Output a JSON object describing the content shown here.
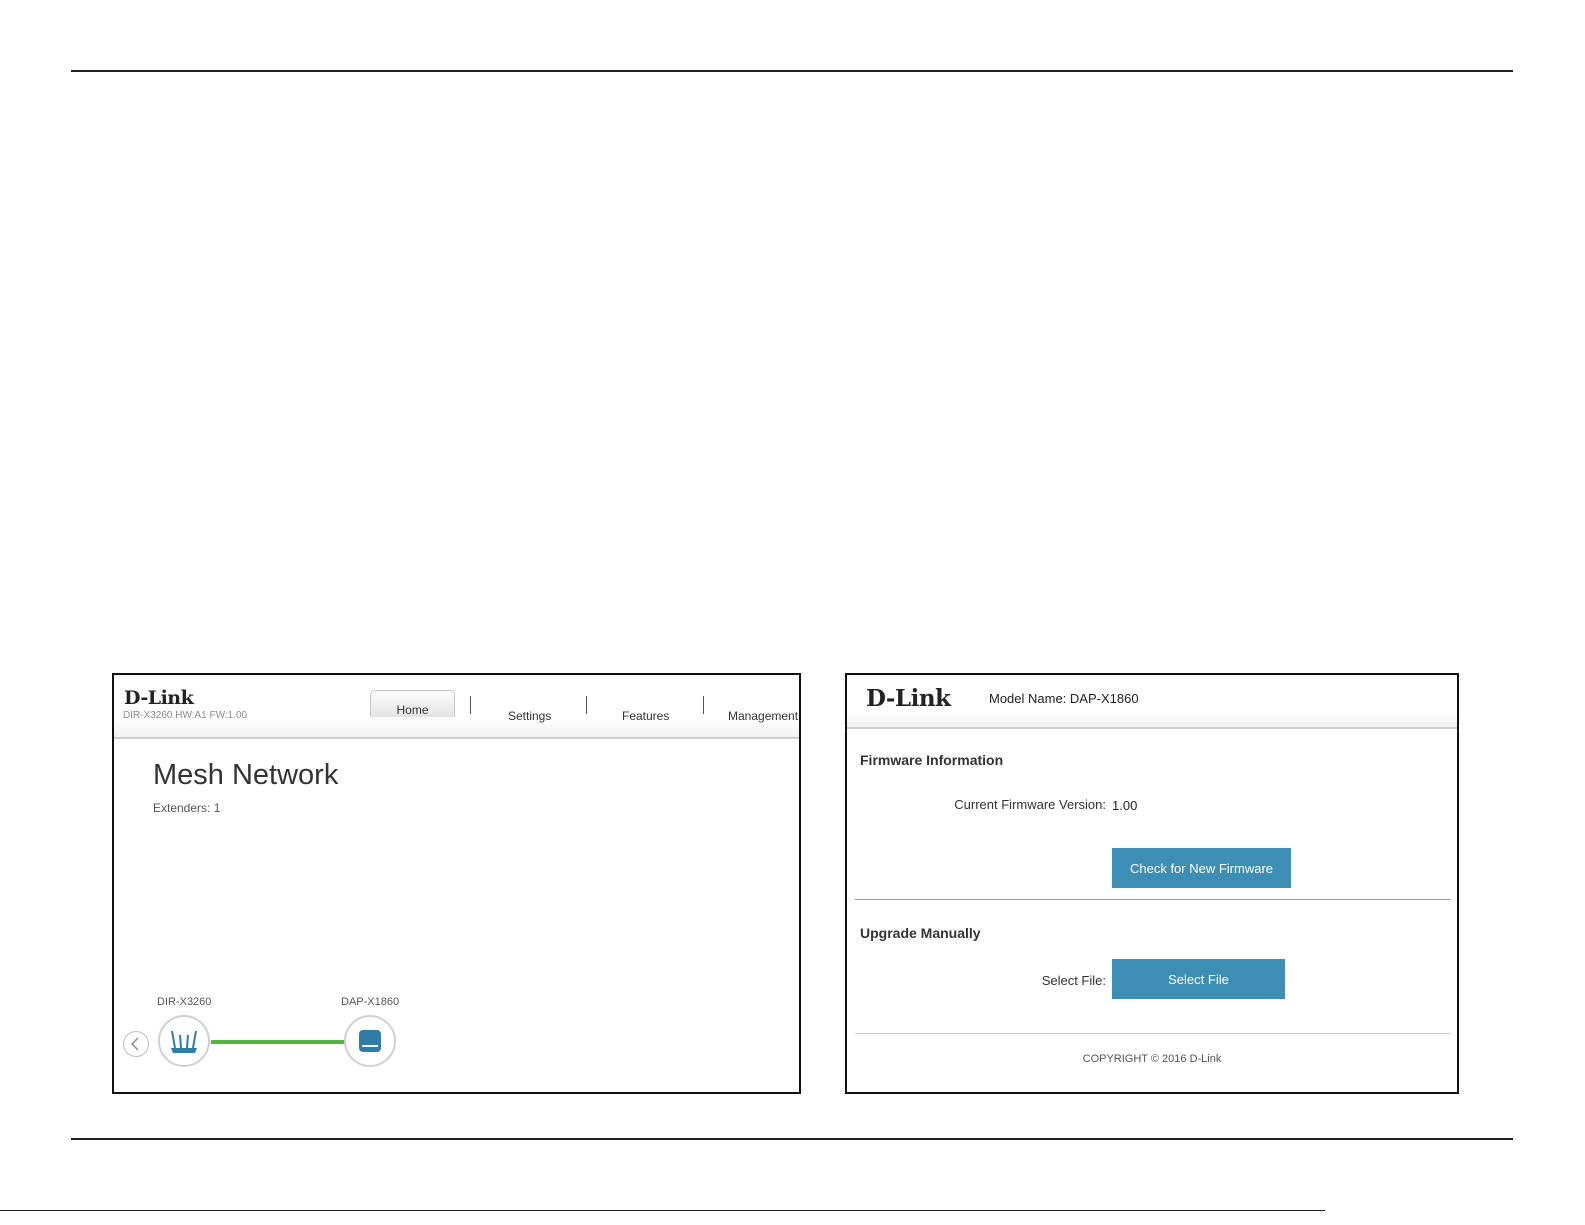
{
  "screenshot_left": {
    "brand": "D-Link",
    "device_info": "DIR-X3260 HW:A1 FW:1.00",
    "nav": [
      {
        "label": "Home",
        "active": true
      },
      {
        "label": "Settings",
        "active": false
      },
      {
        "label": "Features",
        "active": false
      },
      {
        "label": "Management",
        "active": false
      }
    ],
    "page_title": "Mesh Network",
    "extenders_text": "Extenders: 1",
    "devices": [
      {
        "label": "DIR-X3260",
        "icon": "router-icon"
      },
      {
        "label": "DAP-X1860",
        "icon": "extender-icon"
      }
    ],
    "link_color": "#55b342",
    "back_icon": "chevron-left-icon"
  },
  "screenshot_right": {
    "brand": "D-Link",
    "model_name": "Model Name: DAP-X1860",
    "firmware_section_title": "Firmware Information",
    "current_fw_label": "Current Firmware Version:",
    "current_fw_value": "1.00",
    "check_button": "Check for New Firmware",
    "upgrade_section_title": "Upgrade Manually",
    "select_file_label": "Select File:",
    "select_file_button": "Select File",
    "copyright": "COPYRIGHT © 2016 D-Link",
    "button_color": "#3d8eb5"
  }
}
